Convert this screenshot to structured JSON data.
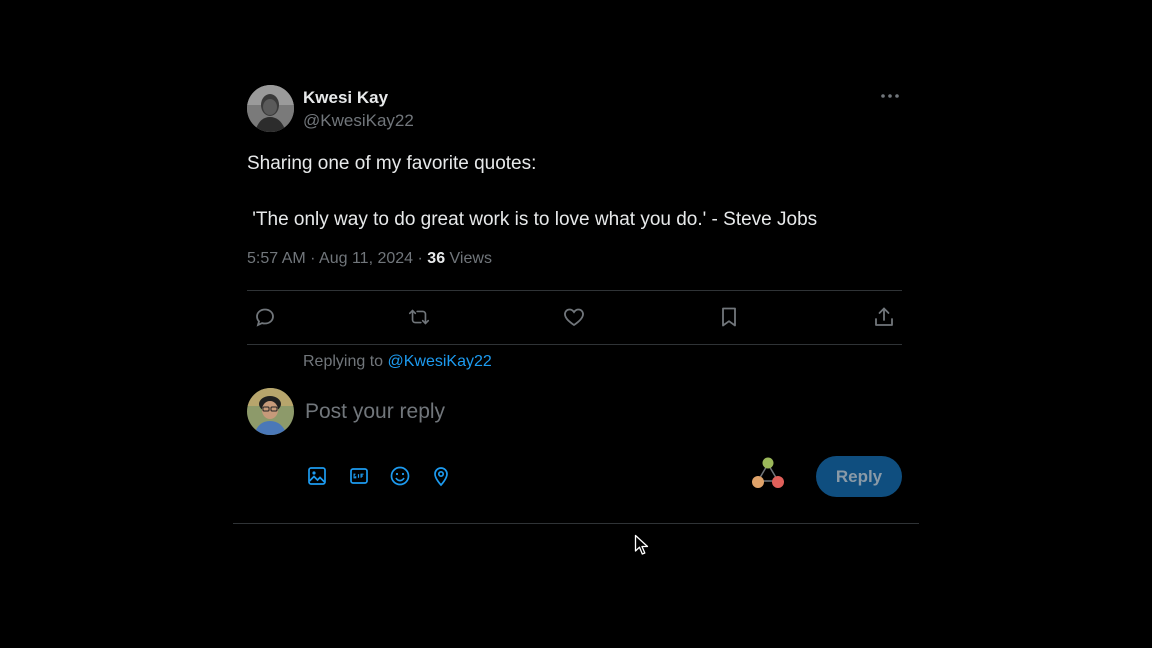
{
  "tweet": {
    "author_name": "Kwesi Kay",
    "author_handle": "@KwesiKay22",
    "body_lines": [
      "Sharing one of my favorite quotes:",
      " 'The only way to do great work is to love what you do.' - Steve Jobs"
    ],
    "time": "5:57 AM",
    "date": "Aug 11, 2024",
    "views_count": "36",
    "views_label": "Views"
  },
  "reply": {
    "replying_to_label": "Replying to",
    "replying_to_handle": "@KwesiKay22",
    "placeholder": "Post your reply",
    "button_label": "Reply"
  },
  "colors": {
    "background": "#000000",
    "text_primary": "#e7e9ea",
    "text_secondary": "#71767b",
    "accent": "#1d9bf0",
    "divider": "#2f3336",
    "reply_button_disabled": "#0f4e7f"
  }
}
